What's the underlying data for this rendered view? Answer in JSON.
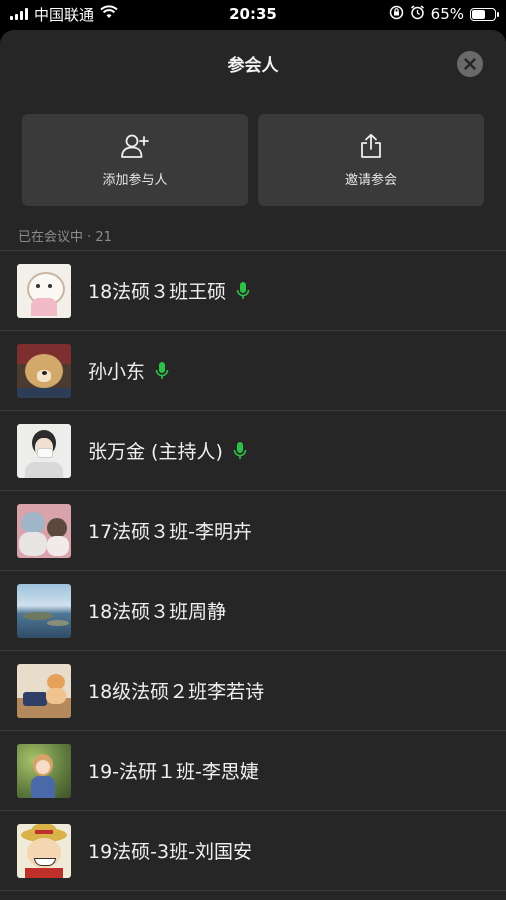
{
  "status_bar": {
    "carrier": "中国联通",
    "time": "20:35",
    "battery": "65%",
    "battery_level": 0.65,
    "icons": [
      "signal-icon",
      "wifi-icon",
      "rotation-lock-icon",
      "alarm-icon",
      "battery-icon"
    ]
  },
  "header": {
    "title": "参会人",
    "close_icon": "close-icon"
  },
  "actions": [
    {
      "label": "添加参与人",
      "icon": "add-person-icon"
    },
    {
      "label": "邀请参会",
      "icon": "share-icon"
    }
  ],
  "section": {
    "label": "已在会议中 · 21"
  },
  "participants": [
    {
      "name": "18法硕３班王硕",
      "speaking": true
    },
    {
      "name": "孙小东",
      "speaking": true
    },
    {
      "name": "张万金 (主持人)",
      "speaking": true
    },
    {
      "name": "17法硕３班-李明卉",
      "speaking": false
    },
    {
      "name": "18法硕３班周静",
      "speaking": false
    },
    {
      "name": "18级法硕２班李若诗",
      "speaking": false
    },
    {
      "name": "19-法研１班-李思婕",
      "speaking": false
    },
    {
      "name": "19法硕-3班-刘国安",
      "speaking": false
    }
  ],
  "colors": {
    "sheet_bg": "#262626",
    "button_bg": "#3a3a3a",
    "mic_green": "#2dbf46"
  }
}
